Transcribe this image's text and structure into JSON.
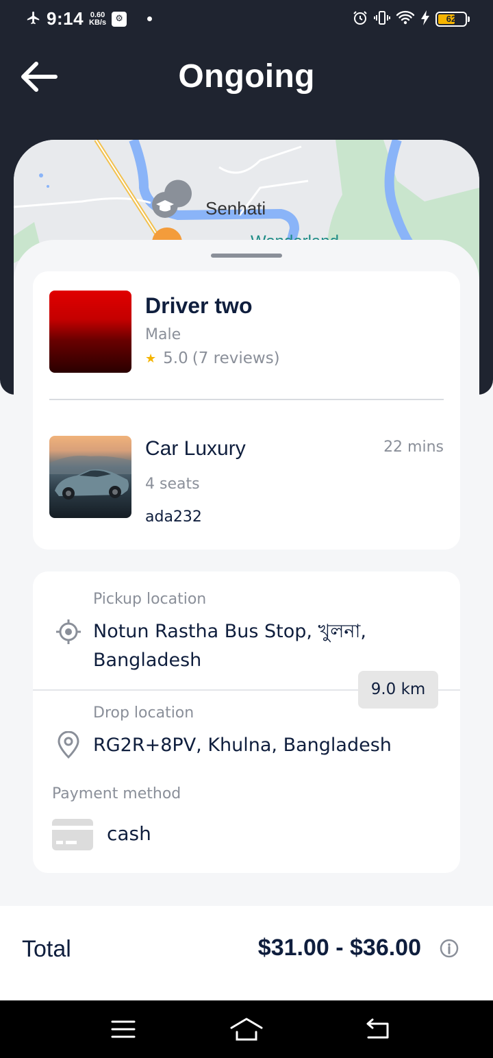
{
  "status_bar": {
    "time": "9:14",
    "speed_value": "0.60",
    "speed_unit": "KB/s",
    "battery_level": "62",
    "icons": [
      "airplane-icon",
      "usb-debug-icon",
      "alarm-icon",
      "vibrate-icon",
      "wifi-icon",
      "charging-icon",
      "battery-icon"
    ]
  },
  "header": {
    "title": "Ongoing",
    "back_icon": "arrow-left-icon"
  },
  "map": {
    "place_label": "Senhati",
    "place_label_2": "Wonderland",
    "marker_icon": "school-pin-icon"
  },
  "driver": {
    "name": "Driver two",
    "gender": "Male",
    "rating": "5.0",
    "reviews": "(7 reviews)"
  },
  "vehicle": {
    "name": "Car Luxury",
    "eta": "22 mins",
    "seats": "4 seats",
    "plate": "ada232"
  },
  "trip": {
    "pickup_label": "Pickup location",
    "pickup_value": "Notun Rastha Bus Stop, খুলনা, Bangladesh",
    "distance": "9.0 km",
    "drop_label": "Drop location",
    "drop_value": "RG2R+8PV, Khulna, Bangladesh",
    "payment_label": "Payment method",
    "payment_value": "cash"
  },
  "footer": {
    "total_label": "Total",
    "total_value": "$31.00 - $36.00"
  },
  "colors": {
    "header_bg": "#1f2430",
    "primary_text": "#0f1e3d",
    "secondary_text": "#8a8f99",
    "star": "#f5b400",
    "battery": "#f5b400"
  }
}
